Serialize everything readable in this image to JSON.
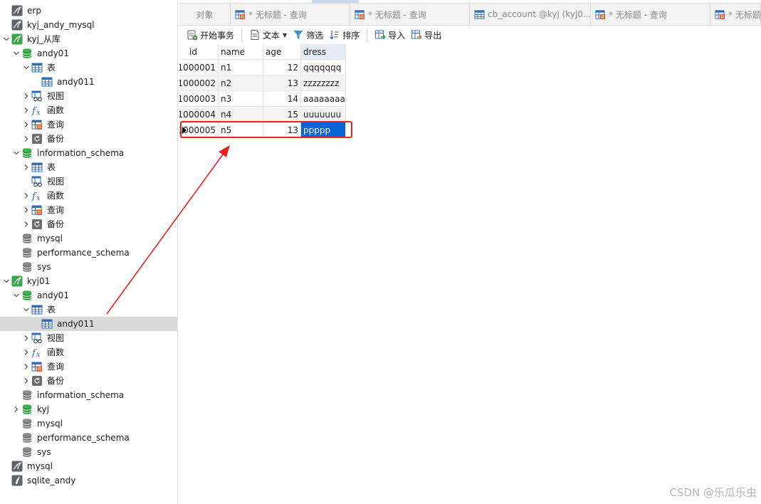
{
  "sidebar": {
    "rows": [
      {
        "label": "erp",
        "icon": "mysql-connection-icon",
        "state": "none",
        "level": 0
      },
      {
        "label": "kyj_andy_mysql",
        "icon": "mysql-connection-icon",
        "state": "none",
        "level": 0
      },
      {
        "label": "kyj_从库",
        "icon": "mysql-connection-open-icon",
        "state": "expanded",
        "level": 0
      },
      {
        "label": "andy01",
        "icon": "database-open-icon",
        "state": "expanded",
        "level": 1
      },
      {
        "label": "表",
        "icon": "table-icon",
        "state": "expanded",
        "level": 2
      },
      {
        "label": "andy011",
        "icon": "table-icon",
        "state": "none",
        "level": 3
      },
      {
        "label": "视图",
        "icon": "view-icon",
        "state": "collapsed",
        "level": 2
      },
      {
        "label": "函数",
        "icon": "function-icon",
        "state": "collapsed",
        "level": 2
      },
      {
        "label": "查询",
        "icon": "query-icon",
        "state": "collapsed",
        "level": 2
      },
      {
        "label": "备份",
        "icon": "backup-icon",
        "state": "collapsed",
        "level": 2
      },
      {
        "label": "information_schema",
        "icon": "database-open-icon",
        "state": "expanded",
        "level": 1
      },
      {
        "label": "表",
        "icon": "table-icon",
        "state": "collapsed",
        "level": 2
      },
      {
        "label": "视图",
        "icon": "view-icon",
        "state": "none",
        "level": 2
      },
      {
        "label": "函数",
        "icon": "function-icon",
        "state": "collapsed",
        "level": 2
      },
      {
        "label": "查询",
        "icon": "query-icon",
        "state": "collapsed",
        "level": 2
      },
      {
        "label": "备份",
        "icon": "backup-icon",
        "state": "collapsed",
        "level": 2
      },
      {
        "label": "mysql",
        "icon": "database-closed-icon",
        "state": "none",
        "level": 1
      },
      {
        "label": "performance_schema",
        "icon": "database-closed-icon",
        "state": "none",
        "level": 1
      },
      {
        "label": "sys",
        "icon": "database-closed-icon",
        "state": "none",
        "level": 1
      },
      {
        "label": "kyj01",
        "icon": "mysql-connection-open-icon",
        "state": "expanded",
        "level": 0
      },
      {
        "label": "andy01",
        "icon": "database-open-icon",
        "state": "expanded",
        "level": 1
      },
      {
        "label": "表",
        "icon": "table-icon",
        "state": "expanded",
        "level": 2
      },
      {
        "label": "andy011",
        "icon": "table-icon",
        "state": "none",
        "level": 3,
        "selected": true
      },
      {
        "label": "视图",
        "icon": "view-icon",
        "state": "collapsed",
        "level": 2
      },
      {
        "label": "函数",
        "icon": "function-icon",
        "state": "collapsed",
        "level": 2
      },
      {
        "label": "查询",
        "icon": "query-icon",
        "state": "collapsed",
        "level": 2
      },
      {
        "label": "备份",
        "icon": "backup-icon",
        "state": "collapsed",
        "level": 2
      },
      {
        "label": "information_schema",
        "icon": "database-closed-icon",
        "state": "none",
        "level": 1
      },
      {
        "label": "kyj",
        "icon": "database-open-icon",
        "state": "collapsed",
        "level": 1
      },
      {
        "label": "mysql",
        "icon": "database-closed-icon",
        "state": "none",
        "level": 1
      },
      {
        "label": "performance_schema",
        "icon": "database-closed-icon",
        "state": "none",
        "level": 1
      },
      {
        "label": "sys",
        "icon": "database-closed-icon",
        "state": "none",
        "level": 1
      },
      {
        "label": "mysql",
        "icon": "mysql-connection-icon",
        "state": "none",
        "level": 0
      },
      {
        "label": "sqlite_andy",
        "icon": "sqlite-connection-icon",
        "state": "none",
        "level": 0
      }
    ]
  },
  "tabs": [
    {
      "label": "对象",
      "icon": ""
    },
    {
      "label": "* 无标题 - 查询",
      "icon": "query-icon"
    },
    {
      "label": "* 无标题 - 查询",
      "icon": "query-icon"
    },
    {
      "label": "cb_account @kyj (kyj0...",
      "icon": "table-icon"
    },
    {
      "label": "* 无标题 - 查询",
      "icon": "query-icon"
    },
    {
      "label": "* 无标题",
      "icon": "query-icon"
    }
  ],
  "toolbar": {
    "begin_transaction": "开始事务",
    "text": "文本",
    "filter": "筛选",
    "sort": "排序",
    "import": "导入",
    "export": "导出"
  },
  "grid": {
    "columns": [
      "id",
      "name",
      "age",
      "dress"
    ],
    "rows": [
      {
        "id": "1000001",
        "name": "n1",
        "age": "12",
        "dress": "qqqqqqq"
      },
      {
        "id": "1000002",
        "name": "n2",
        "age": "13",
        "dress": "zzzzzzzz"
      },
      {
        "id": "1000003",
        "name": "n3",
        "age": "14",
        "dress": "aaaaaaaaa"
      },
      {
        "id": "1000004",
        "name": "n4",
        "age": "15",
        "dress": "uuuuuuu"
      },
      {
        "id": "1000005",
        "name": "n5",
        "age": "13",
        "dress": "ppppp"
      }
    ],
    "current_row": 4,
    "selected_column": "dress"
  },
  "watermark": "CSDN @乐瓜乐虫",
  "colors": {
    "selection": "#0a64d6",
    "annotation_red": "#e8221f",
    "db_green": "#2e9e3c",
    "tree_selected": "#d9d9d9"
  }
}
